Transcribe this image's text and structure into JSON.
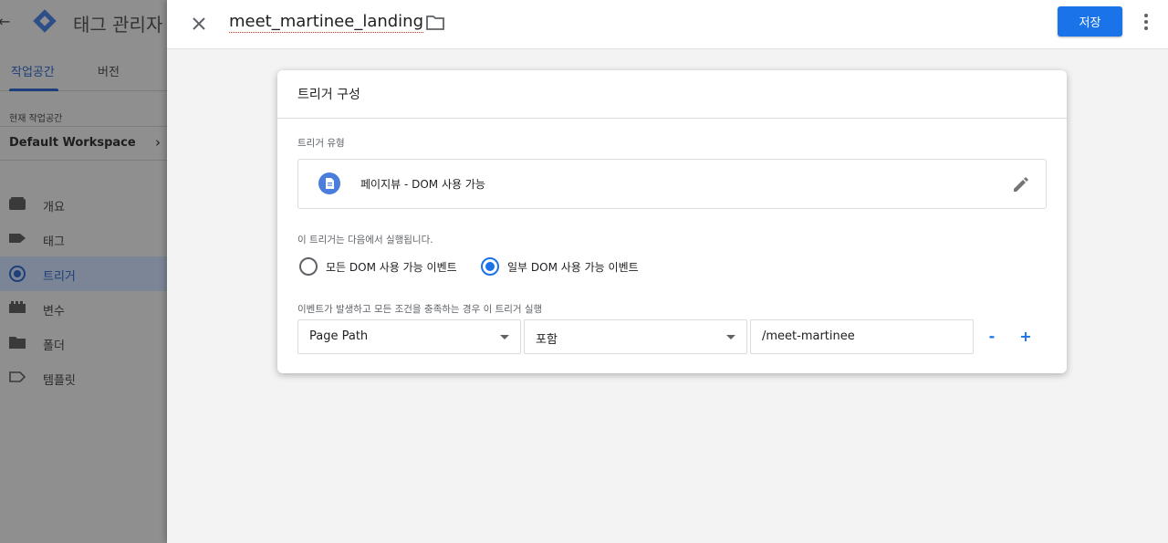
{
  "app": {
    "title": "태그 관리자"
  },
  "sidebar": {
    "tabs": [
      {
        "label": "작업공간",
        "active": true
      },
      {
        "label": "버전",
        "active": false
      }
    ],
    "workspace_label": "현재 작업공간",
    "workspace_name": "Default Workspace",
    "nav": [
      {
        "label": "개요",
        "icon": "overview-icon"
      },
      {
        "label": "태그",
        "icon": "tag-icon"
      },
      {
        "label": "트리거",
        "icon": "trigger-icon",
        "active": true
      },
      {
        "label": "변수",
        "icon": "variable-icon"
      },
      {
        "label": "폴더",
        "icon": "folder-icon"
      },
      {
        "label": "템플릿",
        "icon": "template-icon"
      }
    ]
  },
  "panel": {
    "title": "meet_martinee_landing",
    "save_label": "저장"
  },
  "card": {
    "title": "트리거 구성",
    "type_section_label": "트리거 유형",
    "trigger_type": "페이지뷰 - DOM 사용 가능",
    "fires_on_label": "이 트리거는 다음에서 실행됩니다.",
    "radio_options": [
      {
        "label": "모든 DOM 사용 가능 이벤트",
        "checked": false
      },
      {
        "label": "일부 DOM 사용 가능 이벤트",
        "checked": true
      }
    ],
    "condition_label": "이벤트가 발생하고 모든 조건을 충족하는 경우 이 트리거 실행",
    "condition": {
      "variable": "Page Path",
      "operator": "포함",
      "value": "/meet-martinee",
      "remove_label": "-",
      "add_label": "+"
    }
  },
  "colors": {
    "accent": "#1a73e8",
    "trigger_icon_bg": "#4a7ddc"
  }
}
